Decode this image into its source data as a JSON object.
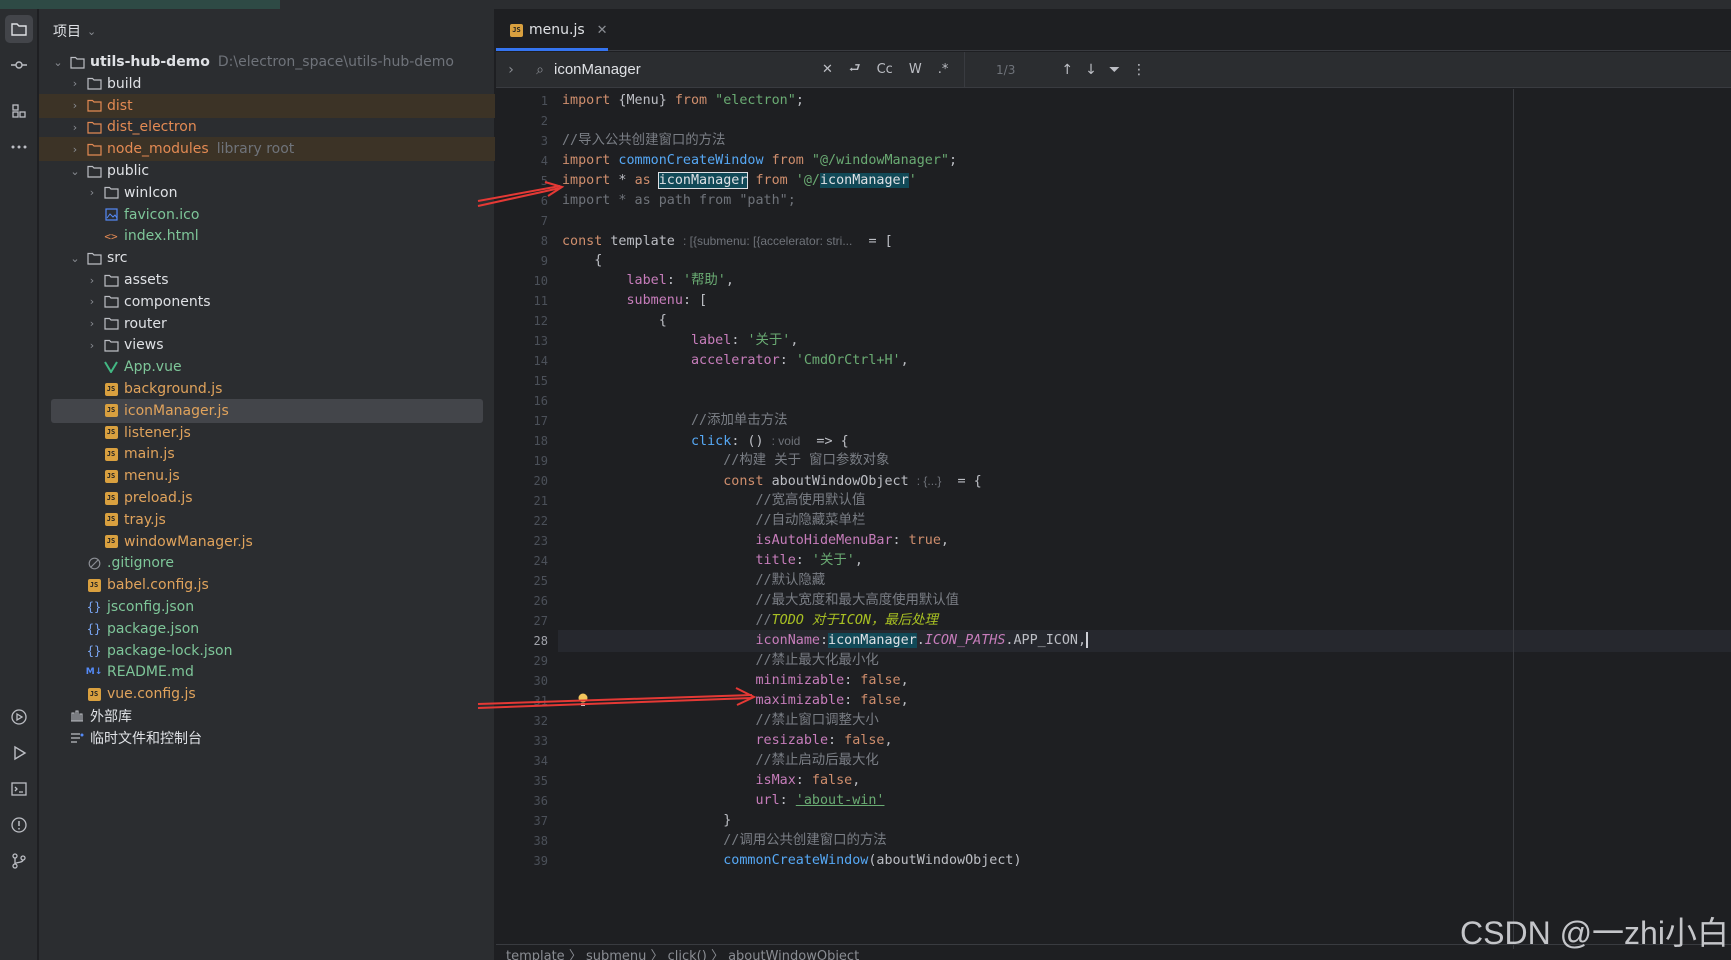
{
  "project_panel": {
    "title": "项目",
    "tree": [
      {
        "label": "utils-hub-demo",
        "hint": "D:\\electron_space\\utils-hub-demo",
        "kind": "folder-root"
      },
      {
        "label": "build",
        "kind": "folder"
      },
      {
        "label": "dist",
        "kind": "folder-excluded"
      },
      {
        "label": "dist_electron",
        "kind": "folder-excluded"
      },
      {
        "label": "node_modules",
        "hint": "library root",
        "kind": "folder-excluded"
      },
      {
        "label": "public",
        "kind": "folder"
      },
      {
        "label": "winIcon",
        "kind": "folder"
      },
      {
        "label": "favicon.ico",
        "kind": "image"
      },
      {
        "label": "index.html",
        "kind": "html"
      },
      {
        "label": "src",
        "kind": "folder"
      },
      {
        "label": "assets",
        "kind": "folder"
      },
      {
        "label": "components",
        "kind": "folder"
      },
      {
        "label": "router",
        "kind": "folder"
      },
      {
        "label": "views",
        "kind": "folder"
      },
      {
        "label": "App.vue",
        "kind": "vue"
      },
      {
        "label": "background.js",
        "kind": "js"
      },
      {
        "label": "iconManager.js",
        "kind": "js"
      },
      {
        "label": "listener.js",
        "kind": "js"
      },
      {
        "label": "main.js",
        "kind": "js"
      },
      {
        "label": "menu.js",
        "kind": "js"
      },
      {
        "label": "preload.js",
        "kind": "js"
      },
      {
        "label": "tray.js",
        "kind": "js"
      },
      {
        "label": "windowManager.js",
        "kind": "js"
      },
      {
        "label": ".gitignore",
        "kind": "ignore"
      },
      {
        "label": "babel.config.js",
        "kind": "js"
      },
      {
        "label": "jsconfig.json",
        "kind": "json"
      },
      {
        "label": "package.json",
        "kind": "json"
      },
      {
        "label": "package-lock.json",
        "kind": "json"
      },
      {
        "label": "README.md",
        "kind": "md"
      },
      {
        "label": "vue.config.js",
        "kind": "js"
      },
      {
        "label": "外部库",
        "kind": "lib"
      },
      {
        "label": "临时文件和控制台",
        "kind": "scratch"
      }
    ]
  },
  "editor": {
    "tab_label": "menu.js",
    "find": {
      "query": "iconManager",
      "case_label": "Cc",
      "word_label": "W",
      "regex_label": ".*",
      "count": "1/3"
    },
    "breadcrumb": "template 〉 submenu 〉 click() 〉 aboutWindowObject",
    "line_numbers": [
      "1",
      "2",
      "3",
      "4",
      "5",
      "6",
      "7",
      "8",
      "9",
      "10",
      "11",
      "12",
      "13",
      "14",
      "15",
      "16",
      "17",
      "18",
      "19",
      "20",
      "21",
      "22",
      "23",
      "24",
      "25",
      "26",
      "27",
      "28",
      "29",
      "30",
      "31",
      "32",
      "33",
      "34",
      "35",
      "36",
      "37",
      "38",
      "39"
    ],
    "code": {
      "l1_kw": "import",
      "l1_a": " {Menu} ",
      "l1_kw2": "from",
      "l1_str": " \"electron\"",
      "l1_end": ";",
      "l3_com": "//导入公共创建窗口的方法",
      "l4_kw": "import",
      "l4_fn": " commonCreateWindow ",
      "l4_kw2": "from",
      "l4_str": " \"@/windowManager\"",
      "l4_end": ";",
      "l5_kw": "import",
      "l5_a": " * ",
      "l5_kw2": "as",
      "l5_match": "iconManager",
      "l5_kw3": "from",
      "l5_str1": " '@/",
      "l5_match2": "iconManager",
      "l5_str2": "'",
      "l6_text": "import * as path from \"path\";",
      "l8_kw": "const",
      "l8_a": " template ",
      "l8_hint": ": [{submenu: [{accelerator: stri...",
      "l8_b": "  = [",
      "l9": "{",
      "l10_prop": "label",
      "l10_a": ": ",
      "l10_str": "'帮助'",
      "l10_b": ",",
      "l11_prop": "submenu",
      "l11_a": ": [",
      "l12": "{",
      "l13_prop": "label",
      "l13_a": ": ",
      "l13_str": "'关于'",
      "l13_b": ",",
      "l14_prop": "accelerator",
      "l14_a": ": ",
      "l14_str": "'CmdOrCtrl+H'",
      "l14_b": ",",
      "l17_com": "//添加单击方法",
      "l18_fn": "click",
      "l18_a": ": () ",
      "l18_hint": ": void",
      "l18_b": "  => {",
      "l19_com": "//构建 关于 窗口参数对象",
      "l20_kw": "const",
      "l20_a": " aboutWindowObject ",
      "l20_hint": ": {...}",
      "l20_b": "  = {",
      "l21_com": "//宽高使用默认值",
      "l22_com": "//自动隐藏菜单栏",
      "l23_prop": "isAutoHideMenuBar",
      "l23_a": ": ",
      "l23_kw": "true",
      "l23_b": ",",
      "l24_prop": "title",
      "l24_a": ": ",
      "l24_str": "'关于'",
      "l24_b": ",",
      "l25_com": "//默认隐藏",
      "l26_com": "//最大宽度和最大高度使用默认值",
      "l27_com": "//",
      "l27_todo": "TODO 对于ICON，最后处理",
      "l28_prop": "iconName",
      "l28_a": ":",
      "l28_match": "iconManager",
      "l28_b": ".",
      "l28_it": "ICON_PATHS",
      "l28_c": ".APP_ICON,",
      "l29_com": "//禁止最大化最小化",
      "l30_prop": "minimizable",
      "l30_a": ": ",
      "l30_kw": "false",
      "l30_b": ",",
      "l31_prop": "maximizable",
      "l31_a": ": ",
      "l31_kw": "false",
      "l31_b": ",",
      "l32_com": "//禁止窗口调整大小",
      "l33_prop": "resizable",
      "l33_a": ": ",
      "l33_kw": "false",
      "l33_b": ",",
      "l34_com": "//禁止启动后最大化",
      "l35_prop": "isMax",
      "l35_a": ": ",
      "l35_kw": "false",
      "l35_b": ",",
      "l36_prop": "url",
      "l36_a": ": ",
      "l36_str": "'about-win'",
      "l37": "}",
      "l38_com": "//调用公共创建窗口的方法",
      "l39_fn": "commonCreateWindow",
      "l39_a": "(aboutWindowObject)"
    }
  },
  "watermark": "CSDN @一zhi小白",
  "colors": {
    "background": "#1e1f22",
    "panel": "#2b2d30",
    "accent": "#3574f0",
    "annotation_arrow": "#e53935"
  }
}
